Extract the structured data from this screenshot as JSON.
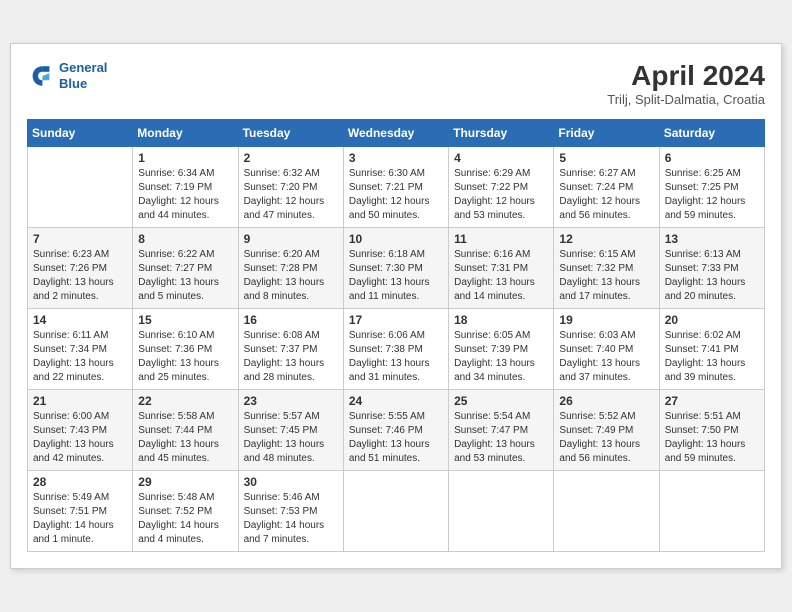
{
  "header": {
    "logo_line1": "General",
    "logo_line2": "Blue",
    "month_year": "April 2024",
    "location": "Trilj, Split-Dalmatia, Croatia"
  },
  "weekdays": [
    "Sunday",
    "Monday",
    "Tuesday",
    "Wednesday",
    "Thursday",
    "Friday",
    "Saturday"
  ],
  "weeks": [
    [
      {
        "day": "",
        "info": ""
      },
      {
        "day": "1",
        "info": "Sunrise: 6:34 AM\nSunset: 7:19 PM\nDaylight: 12 hours\nand 44 minutes."
      },
      {
        "day": "2",
        "info": "Sunrise: 6:32 AM\nSunset: 7:20 PM\nDaylight: 12 hours\nand 47 minutes."
      },
      {
        "day": "3",
        "info": "Sunrise: 6:30 AM\nSunset: 7:21 PM\nDaylight: 12 hours\nand 50 minutes."
      },
      {
        "day": "4",
        "info": "Sunrise: 6:29 AM\nSunset: 7:22 PM\nDaylight: 12 hours\nand 53 minutes."
      },
      {
        "day": "5",
        "info": "Sunrise: 6:27 AM\nSunset: 7:24 PM\nDaylight: 12 hours\nand 56 minutes."
      },
      {
        "day": "6",
        "info": "Sunrise: 6:25 AM\nSunset: 7:25 PM\nDaylight: 12 hours\nand 59 minutes."
      }
    ],
    [
      {
        "day": "7",
        "info": "Sunrise: 6:23 AM\nSunset: 7:26 PM\nDaylight: 13 hours\nand 2 minutes."
      },
      {
        "day": "8",
        "info": "Sunrise: 6:22 AM\nSunset: 7:27 PM\nDaylight: 13 hours\nand 5 minutes."
      },
      {
        "day": "9",
        "info": "Sunrise: 6:20 AM\nSunset: 7:28 PM\nDaylight: 13 hours\nand 8 minutes."
      },
      {
        "day": "10",
        "info": "Sunrise: 6:18 AM\nSunset: 7:30 PM\nDaylight: 13 hours\nand 11 minutes."
      },
      {
        "day": "11",
        "info": "Sunrise: 6:16 AM\nSunset: 7:31 PM\nDaylight: 13 hours\nand 14 minutes."
      },
      {
        "day": "12",
        "info": "Sunrise: 6:15 AM\nSunset: 7:32 PM\nDaylight: 13 hours\nand 17 minutes."
      },
      {
        "day": "13",
        "info": "Sunrise: 6:13 AM\nSunset: 7:33 PM\nDaylight: 13 hours\nand 20 minutes."
      }
    ],
    [
      {
        "day": "14",
        "info": "Sunrise: 6:11 AM\nSunset: 7:34 PM\nDaylight: 13 hours\nand 22 minutes."
      },
      {
        "day": "15",
        "info": "Sunrise: 6:10 AM\nSunset: 7:36 PM\nDaylight: 13 hours\nand 25 minutes."
      },
      {
        "day": "16",
        "info": "Sunrise: 6:08 AM\nSunset: 7:37 PM\nDaylight: 13 hours\nand 28 minutes."
      },
      {
        "day": "17",
        "info": "Sunrise: 6:06 AM\nSunset: 7:38 PM\nDaylight: 13 hours\nand 31 minutes."
      },
      {
        "day": "18",
        "info": "Sunrise: 6:05 AM\nSunset: 7:39 PM\nDaylight: 13 hours\nand 34 minutes."
      },
      {
        "day": "19",
        "info": "Sunrise: 6:03 AM\nSunset: 7:40 PM\nDaylight: 13 hours\nand 37 minutes."
      },
      {
        "day": "20",
        "info": "Sunrise: 6:02 AM\nSunset: 7:41 PM\nDaylight: 13 hours\nand 39 minutes."
      }
    ],
    [
      {
        "day": "21",
        "info": "Sunrise: 6:00 AM\nSunset: 7:43 PM\nDaylight: 13 hours\nand 42 minutes."
      },
      {
        "day": "22",
        "info": "Sunrise: 5:58 AM\nSunset: 7:44 PM\nDaylight: 13 hours\nand 45 minutes."
      },
      {
        "day": "23",
        "info": "Sunrise: 5:57 AM\nSunset: 7:45 PM\nDaylight: 13 hours\nand 48 minutes."
      },
      {
        "day": "24",
        "info": "Sunrise: 5:55 AM\nSunset: 7:46 PM\nDaylight: 13 hours\nand 51 minutes."
      },
      {
        "day": "25",
        "info": "Sunrise: 5:54 AM\nSunset: 7:47 PM\nDaylight: 13 hours\nand 53 minutes."
      },
      {
        "day": "26",
        "info": "Sunrise: 5:52 AM\nSunset: 7:49 PM\nDaylight: 13 hours\nand 56 minutes."
      },
      {
        "day": "27",
        "info": "Sunrise: 5:51 AM\nSunset: 7:50 PM\nDaylight: 13 hours\nand 59 minutes."
      }
    ],
    [
      {
        "day": "28",
        "info": "Sunrise: 5:49 AM\nSunset: 7:51 PM\nDaylight: 14 hours\nand 1 minute."
      },
      {
        "day": "29",
        "info": "Sunrise: 5:48 AM\nSunset: 7:52 PM\nDaylight: 14 hours\nand 4 minutes."
      },
      {
        "day": "30",
        "info": "Sunrise: 5:46 AM\nSunset: 7:53 PM\nDaylight: 14 hours\nand 7 minutes."
      },
      {
        "day": "",
        "info": ""
      },
      {
        "day": "",
        "info": ""
      },
      {
        "day": "",
        "info": ""
      },
      {
        "day": "",
        "info": ""
      }
    ]
  ]
}
